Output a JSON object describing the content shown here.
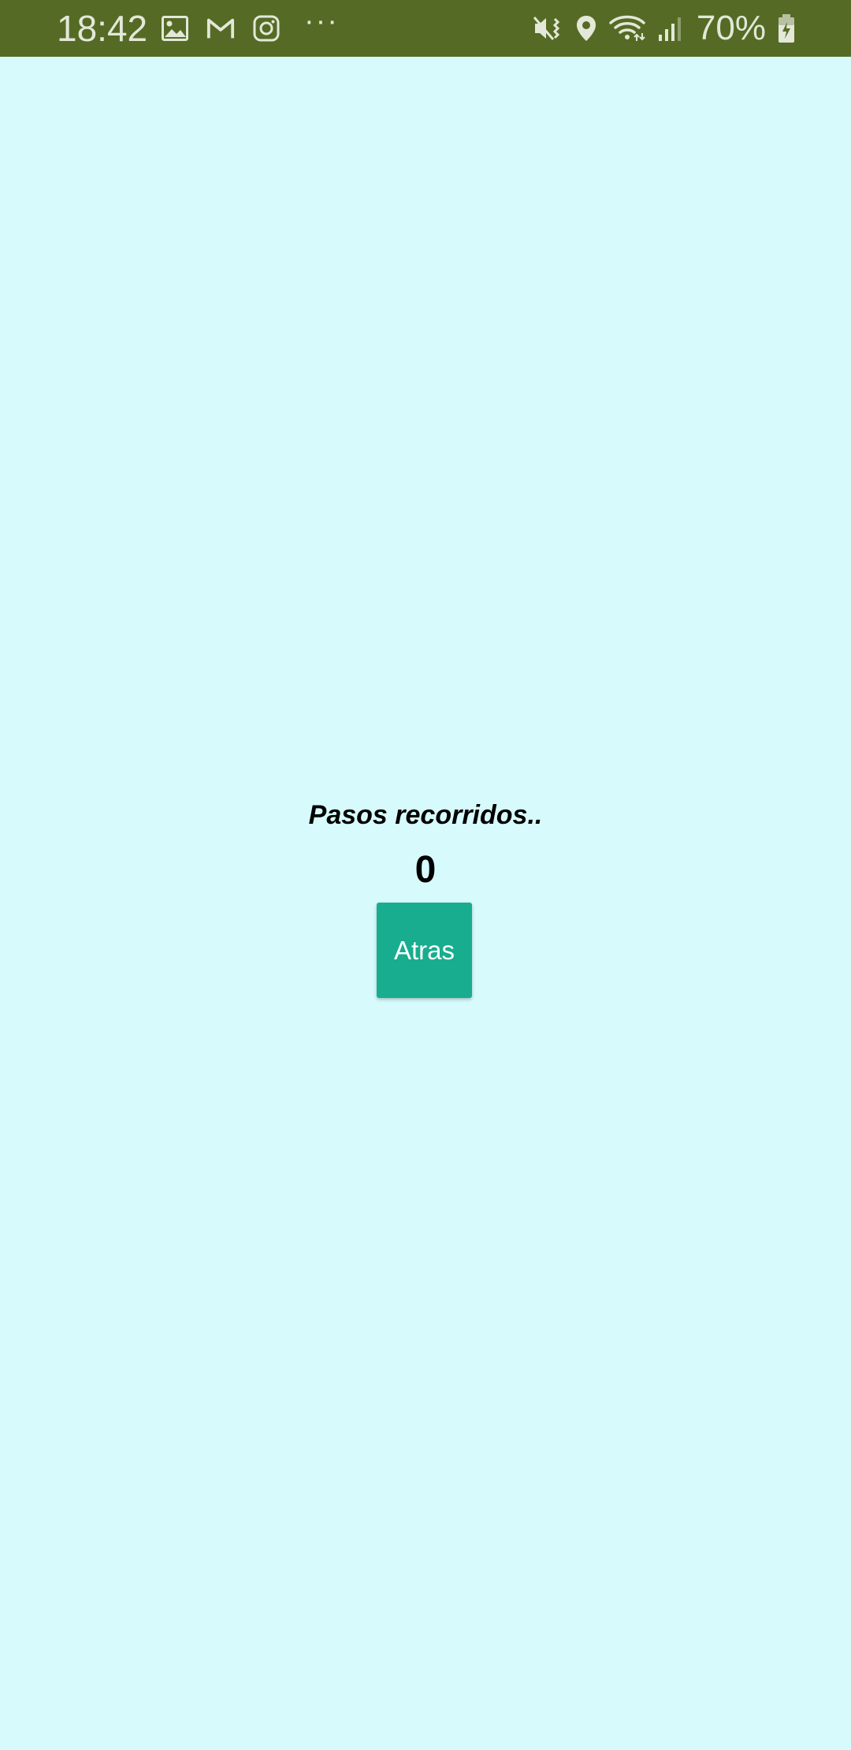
{
  "status_bar": {
    "time": "18:42",
    "notification_icons": [
      "gallery-icon",
      "gmail-icon",
      "instagram-icon"
    ],
    "more": "···",
    "system_icons": [
      "mute-vibrate-icon",
      "location-icon",
      "wifi-icon",
      "signal-icon",
      "battery-charging-icon"
    ],
    "battery": "70%",
    "background_color": "#556b25"
  },
  "main": {
    "steps_label": "Pasos recorridos..",
    "steps_count": "0",
    "back_button_label": "Atras",
    "background_color": "#d7fbfd",
    "button_color": "#17ad8e"
  }
}
